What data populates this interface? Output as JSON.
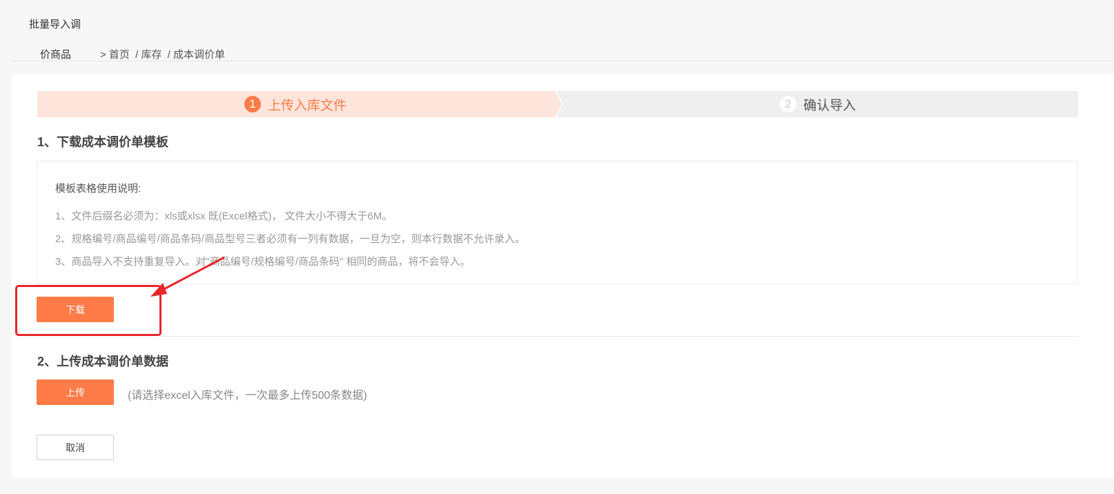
{
  "header": {
    "title_line1": "批量导入调",
    "title_line2": "价商品",
    "breadcrumb": [
      "> 首页",
      "/ 库存",
      "/ 成本调价单"
    ]
  },
  "steps": [
    {
      "number": "1",
      "label": "上传入库文件",
      "active": true
    },
    {
      "number": "2",
      "label": "确认导入",
      "active": false
    }
  ],
  "section1": {
    "title": "1、下载成本调价单模板",
    "desc_title": "模板表格使用说明:",
    "desc_lines": [
      "1、文件后缀名必须为：xls或xlsx 既(Excel格式)， 文件大小不得大于6M。",
      "2、规格编号/商品编号/商品条码/商品型号三者必须有一列有数据，一旦为空，则本行数据不允许录入。",
      "3、商品导入不支持重复导入。对\"商品编号/规格编号/商品条码\" 相同的商品，将不会导入。"
    ],
    "download_label": "下载"
  },
  "section2": {
    "title": "2、上传成本调价单数据",
    "upload_label": "上传",
    "hint": "(请选择excel入库文件，一次最多上传500条数据)"
  },
  "cancel_label": "取消",
  "colors": {
    "accent": "#ff7b47",
    "step_active_bg": "#fde5dc",
    "step_inactive_bg": "#efefef",
    "annotation": "#e8252a"
  }
}
